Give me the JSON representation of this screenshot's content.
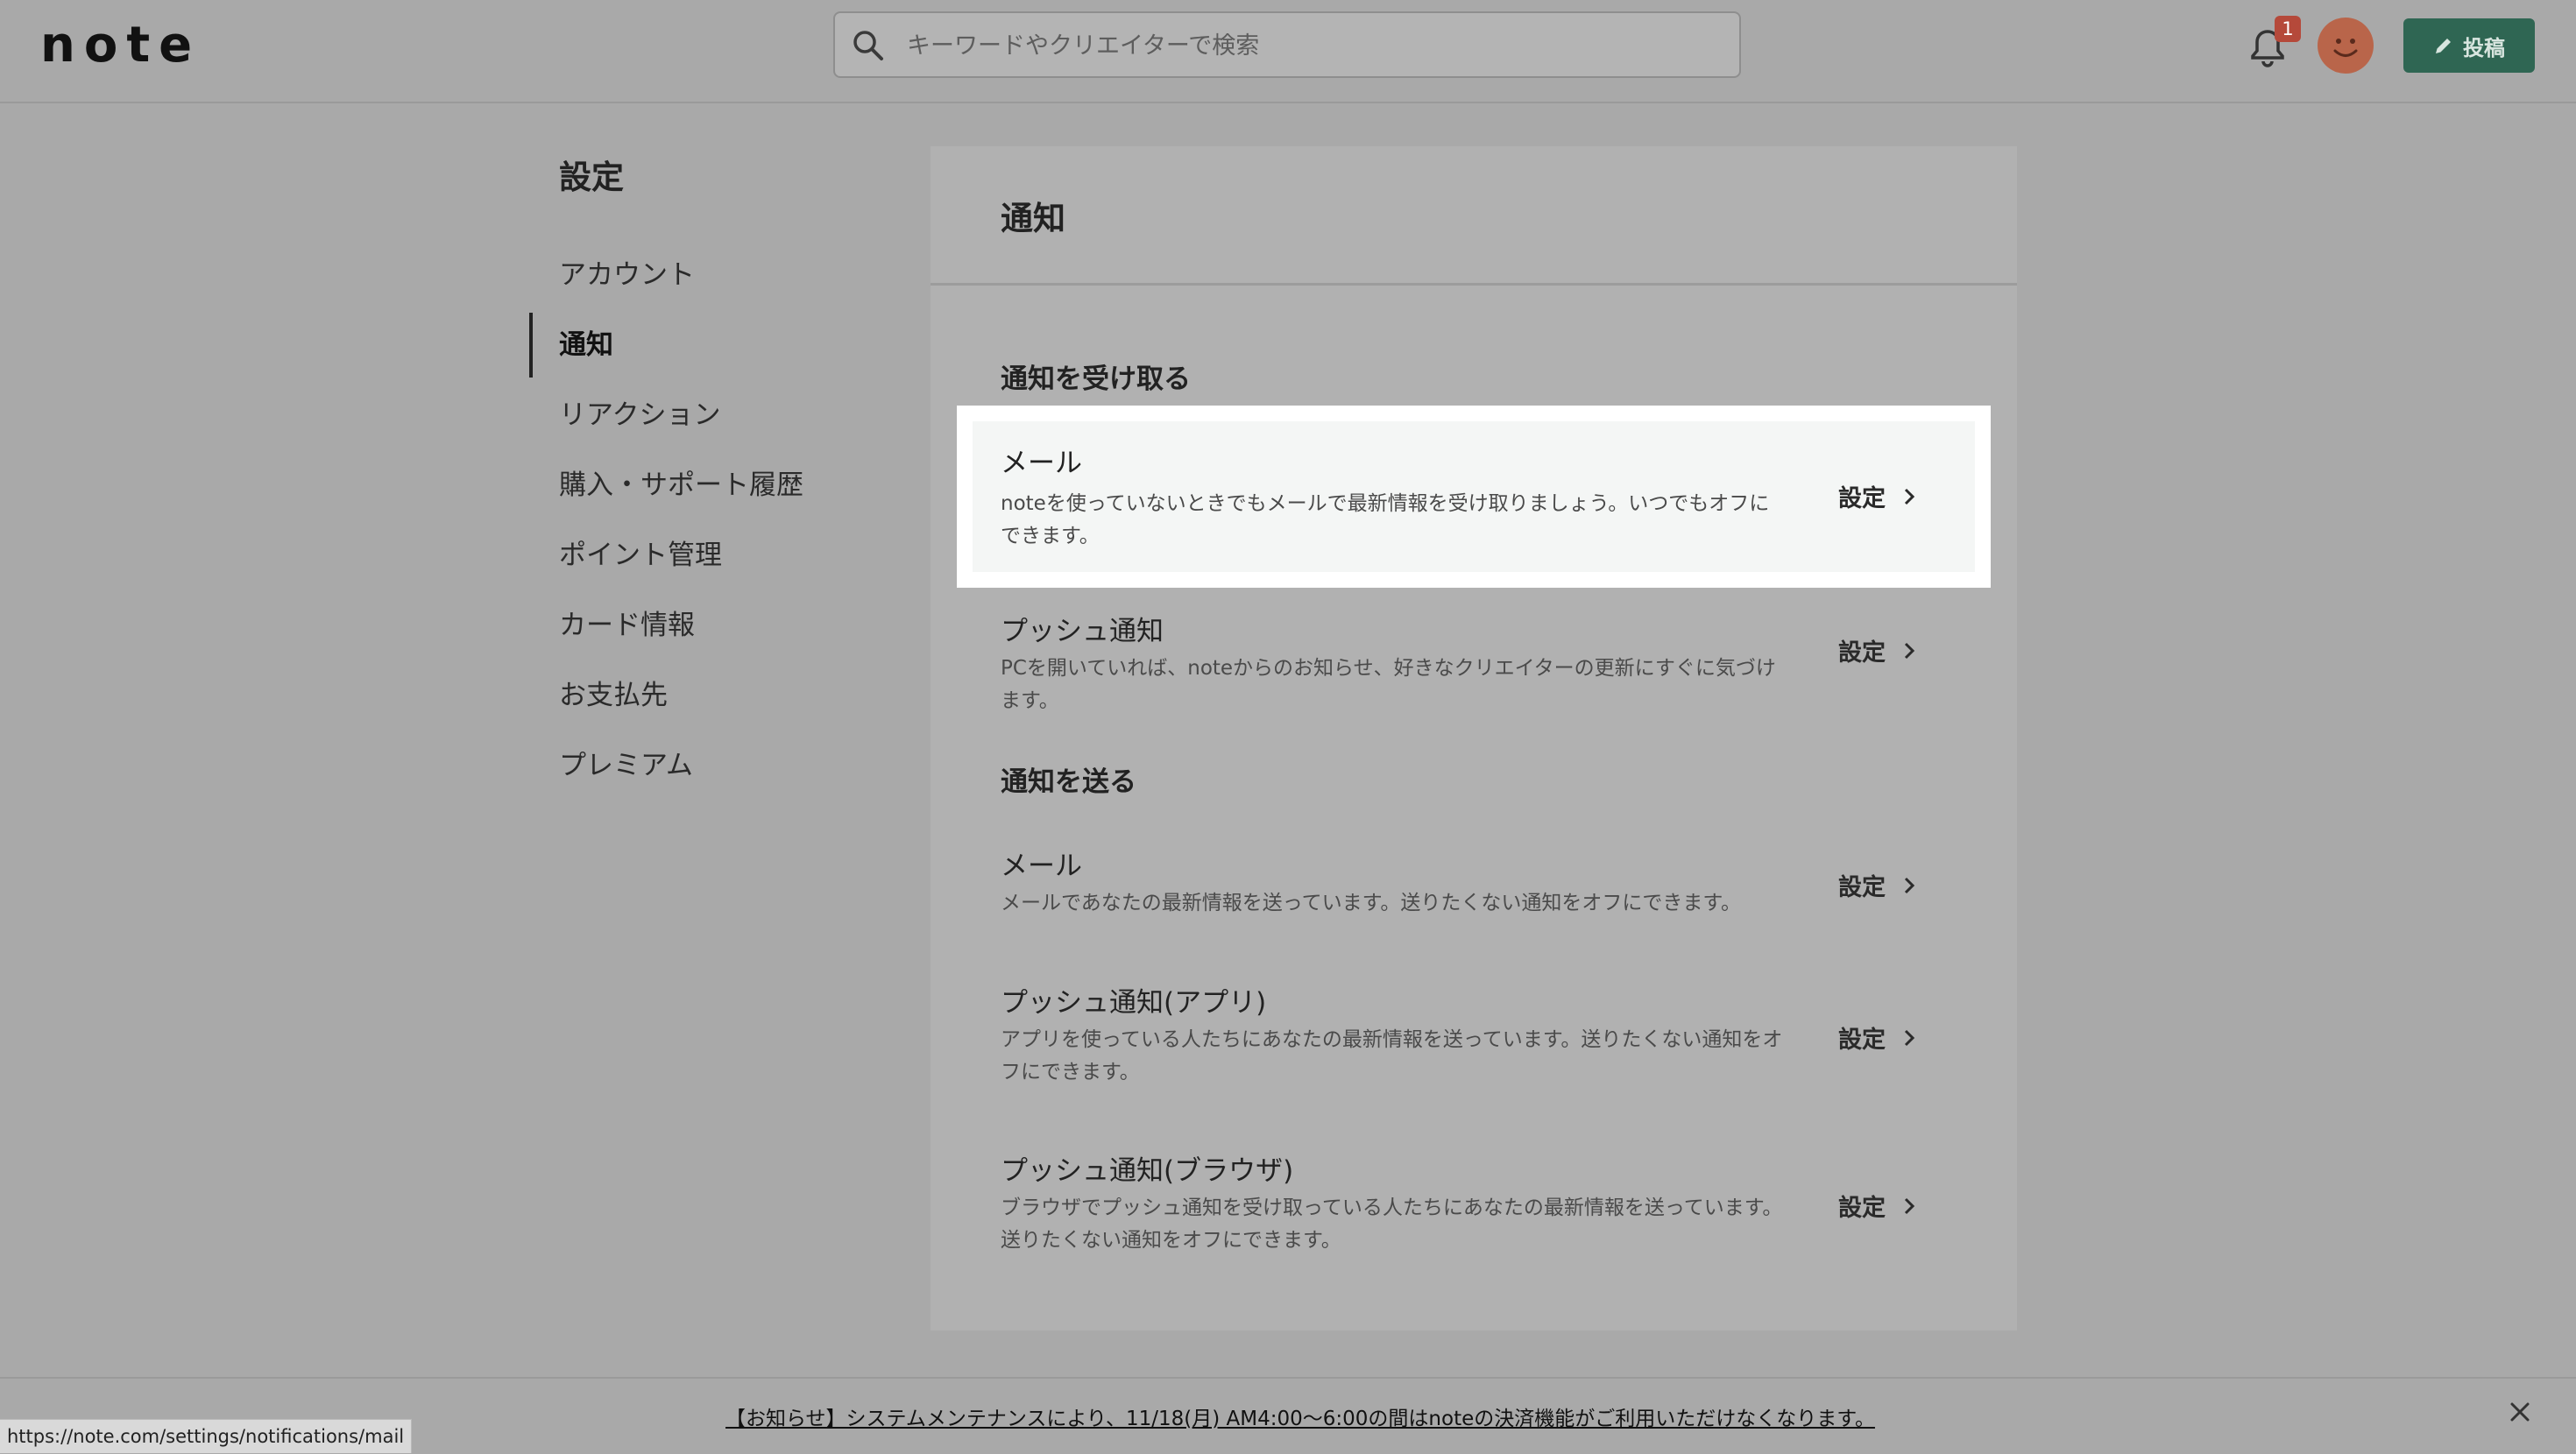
{
  "header": {
    "logo": "note",
    "search_placeholder": "キーワードやクリエイターで検索",
    "notification_count": "1",
    "post_label": "投稿"
  },
  "sidebar": {
    "title": "設定",
    "items": [
      {
        "label": "アカウント",
        "active": false
      },
      {
        "label": "通知",
        "active": true
      },
      {
        "label": "リアクション",
        "active": false
      },
      {
        "label": "購入・サポート履歴",
        "active": false
      },
      {
        "label": "ポイント管理",
        "active": false
      },
      {
        "label": "カード情報",
        "active": false
      },
      {
        "label": "お支払先",
        "active": false
      },
      {
        "label": "プレミアム",
        "active": false
      }
    ]
  },
  "main": {
    "title": "通知",
    "receive": {
      "title": "通知を受け取る",
      "rows": [
        {
          "name": "メール",
          "desc": "noteを使っていないときでもメールで最新情報を受け取りましょう。いつでもオフにできます。",
          "action": "設定"
        },
        {
          "name": "プッシュ通知",
          "desc": "PCを開いていれば、noteからのお知らせ、好きなクリエイターの更新にすぐに気づけます。",
          "action": "設定"
        }
      ]
    },
    "send": {
      "title": "通知を送る",
      "rows": [
        {
          "name": "メール",
          "desc": "メールであなたの最新情報を送っています。送りたくない通知をオフにできます。",
          "action": "設定"
        },
        {
          "name": "プッシュ通知(アプリ)",
          "desc": "アプリを使っている人たちにあなたの最新情報を送っています。送りたくない通知をオフにできます。",
          "action": "設定"
        },
        {
          "name": "プッシュ通知(ブラウザ)",
          "desc": "ブラウザでプッシュ通知を受け取っている人たちにあなたの最新情報を送っています。送りたくない通知をオフにできます。",
          "action": "設定"
        }
      ]
    }
  },
  "notice": {
    "text": "【お知らせ】システムメンテナンスにより、11/18(月) AM4:00〜6:00の間はnoteの決済機能がご利用いただけなくなります。"
  },
  "status_url": "https://note.com/settings/notifications/mail",
  "colors": {
    "accent": "#2f6653",
    "badge": "#b5493a",
    "overlay_bg": "#a9a9a9",
    "highlight_bg": "#f4f6f5"
  }
}
